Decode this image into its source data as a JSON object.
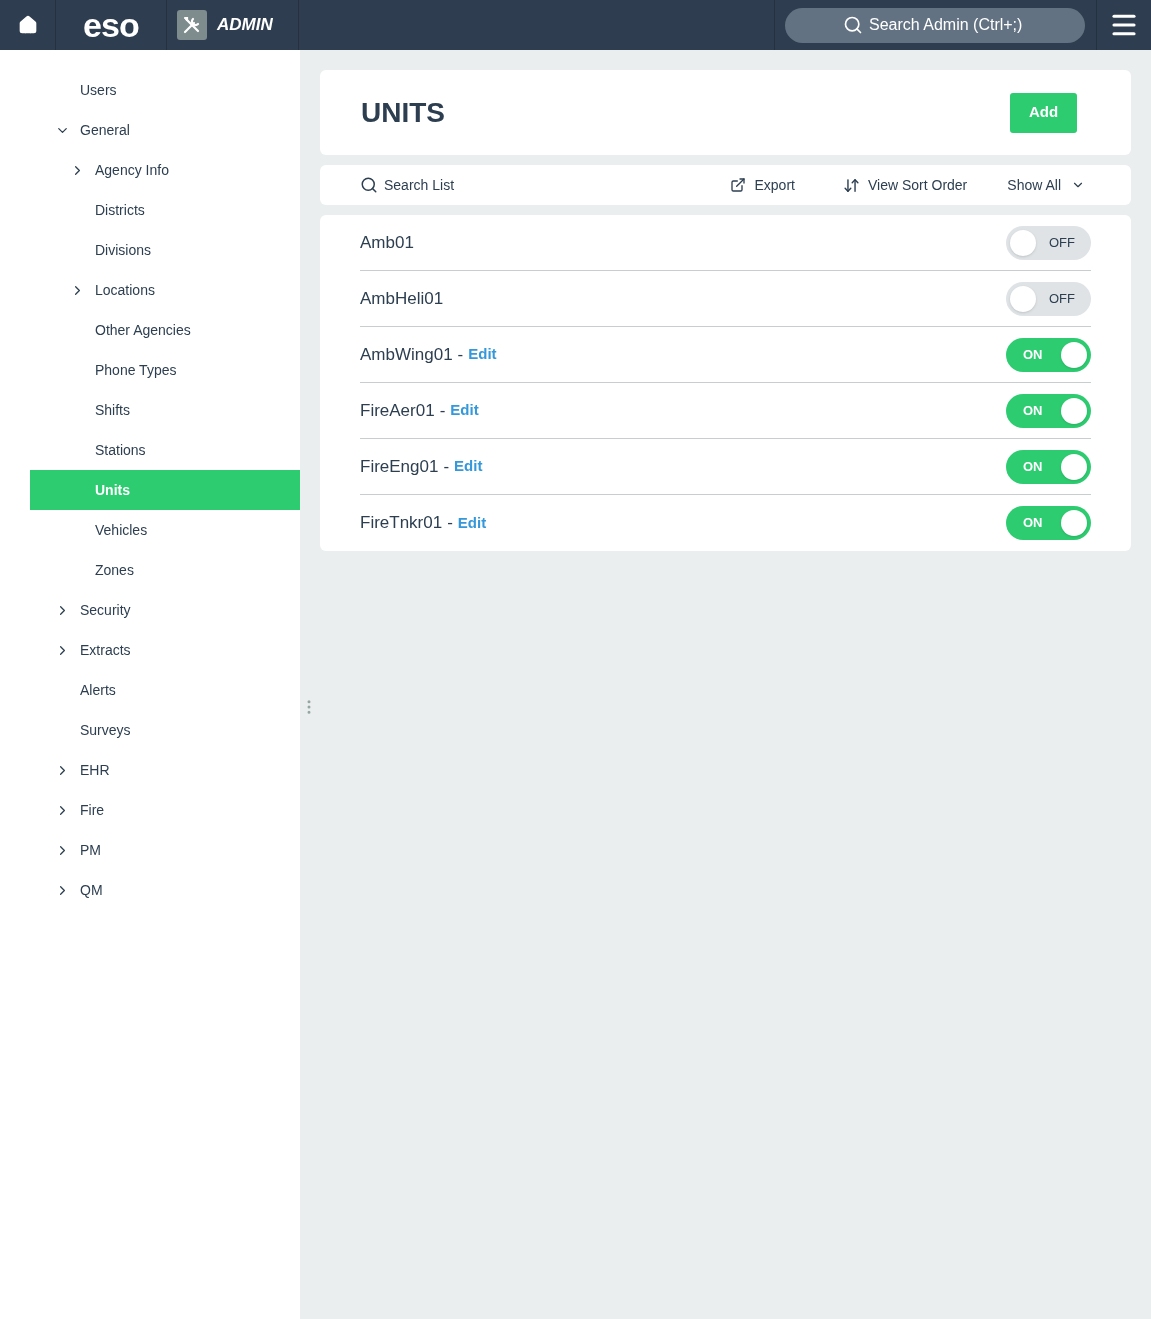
{
  "header": {
    "logo": "eso",
    "app_label": "ADMIN",
    "search": {
      "placeholder": "Search Admin (Ctrl+;)"
    }
  },
  "sidebar": {
    "items": [
      {
        "label": "Users",
        "kind": "link",
        "selected": false
      },
      {
        "label": "General",
        "kind": "group",
        "expanded": true,
        "selected": false,
        "children": [
          {
            "label": "Agency Info",
            "kind": "group",
            "expanded": false,
            "selected": false
          },
          {
            "label": "Districts",
            "kind": "link",
            "selected": false
          },
          {
            "label": "Divisions",
            "kind": "link",
            "selected": false
          },
          {
            "label": "Locations",
            "kind": "group",
            "expanded": false,
            "selected": false
          },
          {
            "label": "Other Agencies",
            "kind": "link",
            "selected": false
          },
          {
            "label": "Phone Types",
            "kind": "link",
            "selected": false
          },
          {
            "label": "Shifts",
            "kind": "link",
            "selected": false
          },
          {
            "label": "Stations",
            "kind": "link",
            "selected": false
          },
          {
            "label": "Units",
            "kind": "link",
            "selected": true
          },
          {
            "label": "Vehicles",
            "kind": "link",
            "selected": false
          },
          {
            "label": "Zones",
            "kind": "link",
            "selected": false
          }
        ]
      },
      {
        "label": "Security",
        "kind": "group",
        "expanded": false,
        "selected": false
      },
      {
        "label": "Extracts",
        "kind": "group",
        "expanded": false,
        "selected": false
      },
      {
        "label": "Alerts",
        "kind": "link",
        "selected": false
      },
      {
        "label": "Surveys",
        "kind": "link",
        "selected": false
      },
      {
        "label": "EHR",
        "kind": "group",
        "expanded": false,
        "selected": false
      },
      {
        "label": "Fire",
        "kind": "group",
        "expanded": false,
        "selected": false
      },
      {
        "label": "PM",
        "kind": "group",
        "expanded": false,
        "selected": false
      },
      {
        "label": "QM",
        "kind": "group",
        "expanded": false,
        "selected": false
      }
    ]
  },
  "page": {
    "title": "UNITS",
    "add_button": "Add"
  },
  "toolbar": {
    "search": {
      "placeholder": "Search List"
    },
    "export": "Export",
    "sort": "View Sort Order",
    "filter": "Show All"
  },
  "units": [
    {
      "name": "Amb01",
      "on": false,
      "toggle_label": "OFF"
    },
    {
      "name": "AmbHeli01",
      "on": false,
      "toggle_label": "OFF"
    },
    {
      "name": "AmbWing01",
      "separator": "-",
      "edit": "Edit",
      "on": true,
      "toggle_label": "ON"
    },
    {
      "name": "FireAer01",
      "separator": "-",
      "edit": "Edit",
      "on": true,
      "toggle_label": "ON"
    },
    {
      "name": "FireEng01",
      "separator": "-",
      "edit": "Edit",
      "on": true,
      "toggle_label": "ON"
    },
    {
      "name": "FireTnkr01",
      "separator": "-",
      "edit": "Edit",
      "on": true,
      "toggle_label": "ON"
    }
  ]
}
